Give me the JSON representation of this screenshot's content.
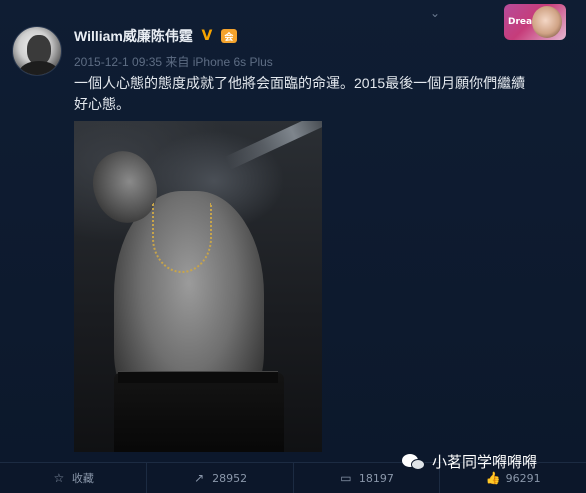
{
  "post": {
    "username": "William威廉陈伟霆",
    "verified_mark": "V",
    "member_mark": "会",
    "timestamp": "2015-12-1 09:35",
    "source": "来自 iPhone 6s Plus",
    "text": "一個人心態的態度成就了他將会面臨的命運。2015最後一個月願你們繼續好心態。"
  },
  "badge": {
    "label": "Dream"
  },
  "actions": {
    "favorite_label": "收藏",
    "repost_count": "28952",
    "comment_count": "18197",
    "like_count": "96291"
  },
  "watermark": {
    "text": "小茗同学嘚嘚嘚"
  }
}
